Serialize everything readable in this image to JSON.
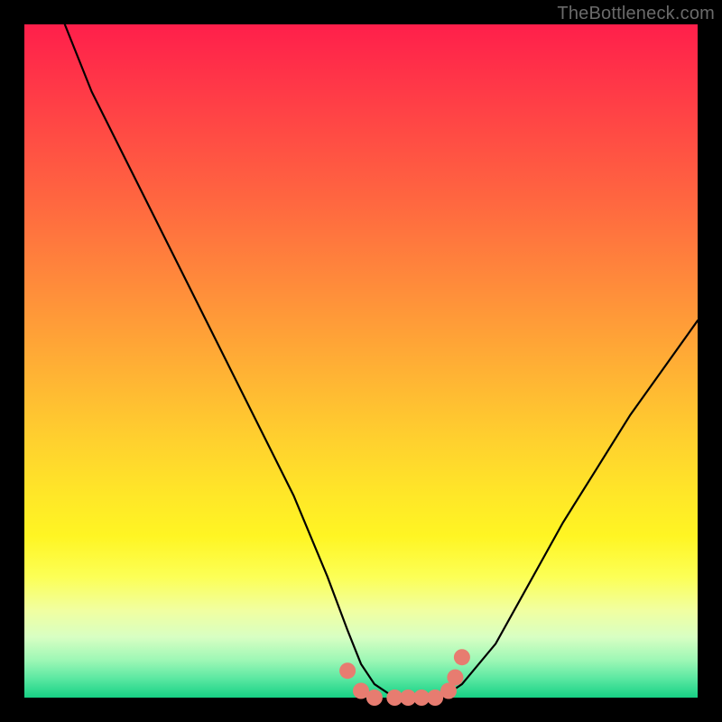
{
  "watermark": "TheBottleneck.com",
  "chart_data": {
    "type": "line",
    "title": "",
    "xlabel": "",
    "ylabel": "",
    "xlim": [
      0,
      100
    ],
    "ylim": [
      0,
      100
    ],
    "grid": false,
    "series": [
      {
        "name": "curve",
        "color": "#000000",
        "x": [
          6,
          10,
          15,
          20,
          25,
          30,
          35,
          40,
          45,
          48,
          50,
          52,
          55,
          58,
          60,
          62,
          65,
          70,
          75,
          80,
          85,
          90,
          95,
          100
        ],
        "y": [
          100,
          90,
          80,
          70,
          60,
          50,
          40,
          30,
          18,
          10,
          5,
          2,
          0,
          0,
          0,
          0,
          2,
          8,
          17,
          26,
          34,
          42,
          49,
          56
        ]
      }
    ],
    "markers": {
      "name": "salmon-dots",
      "color": "#e77c70",
      "points": [
        {
          "x": 48,
          "y": 4
        },
        {
          "x": 50,
          "y": 1
        },
        {
          "x": 52,
          "y": 0
        },
        {
          "x": 55,
          "y": 0
        },
        {
          "x": 57,
          "y": 0
        },
        {
          "x": 59,
          "y": 0
        },
        {
          "x": 61,
          "y": 0
        },
        {
          "x": 63,
          "y": 1
        },
        {
          "x": 64,
          "y": 3
        },
        {
          "x": 65,
          "y": 6
        }
      ]
    }
  }
}
